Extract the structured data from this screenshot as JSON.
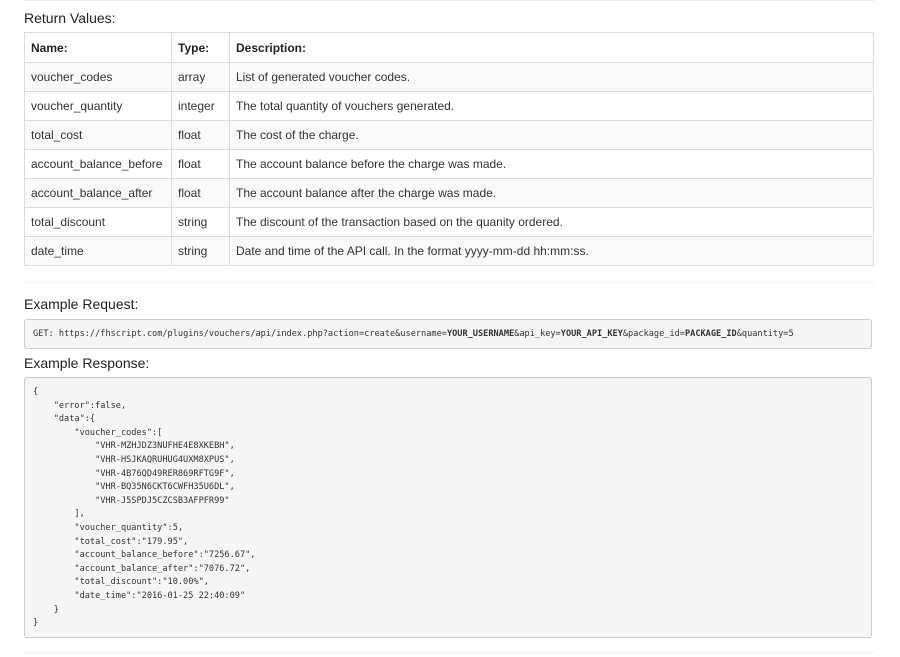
{
  "return_values": {
    "heading": "Return Values:",
    "headers": [
      "Name:",
      "Type:",
      "Description:"
    ],
    "rows": [
      {
        "name": "voucher_codes",
        "type": "array",
        "description": "List of generated voucher codes."
      },
      {
        "name": "voucher_quantity",
        "type": "integer",
        "description": "The total quantity of vouchers generated."
      },
      {
        "name": "total_cost",
        "type": "float",
        "description": "The cost of the charge."
      },
      {
        "name": "account_balance_before",
        "type": "float",
        "description": "The account balance before the charge was made."
      },
      {
        "name": "account_balance_after",
        "type": "float",
        "description": "The account balance after the charge was made."
      },
      {
        "name": "total_discount",
        "type": "string",
        "description": "The discount of the transaction based on the quanity ordered."
      },
      {
        "name": "date_time",
        "type": "string",
        "description": "Date and time of the API call. In the format yyyy-mm-dd hh:mm:ss."
      }
    ]
  },
  "example_request": {
    "heading": "Example Request:",
    "method": "GET:",
    "url_part1": "https://fhscript.com/plugins/vouchers/api/index.php?action=create&username=",
    "username_placeholder": "YOUR_USERNAME",
    "url_part2": "&api_key=",
    "api_key_placeholder": "YOUR_API_KEY",
    "url_part3": "&package_id=",
    "package_id_placeholder": "PACKAGE_ID",
    "url_part4": "&quantity=5"
  },
  "example_response": {
    "heading": "Example Response:",
    "code": "{\n    \"error\":false,\n    \"data\":{\n        \"voucher_codes\":[\n            \"VHR-MZHJDZ3NUFHE4E8XKEBH\",\n            \"VHR-HSJKAQRUHUG4UXM8XPUS\",\n            \"VHR-4B76QD49RER869RFTG9F\",\n            \"VHR-BQ35N6CKT6CWFH35U6DL\",\n            \"VHR-J5SPDJ5CZCSB3AFPFR99\"\n        ],\n        \"voucher_quantity\":5,\n        \"total_cost\":\"179.95\",\n        \"account_balance_before\":\"7256.67\",\n        \"account_balance_after\":\"7076.72\",\n        \"total_discount\":\"10.00%\",\n        \"date_time\":\"2016-01-25 22:40:09\"\n    }\n}"
  }
}
